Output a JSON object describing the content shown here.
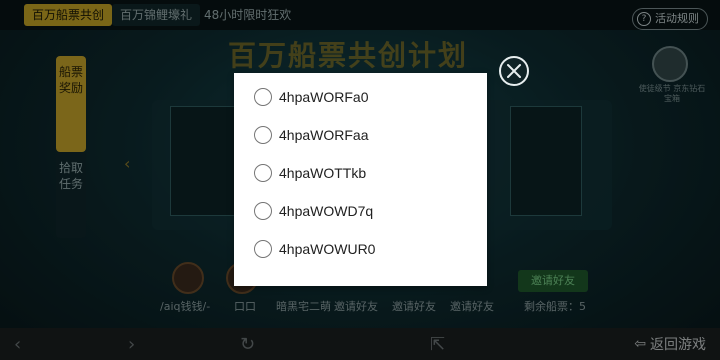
{
  "top_tabs": [
    {
      "label": "百万船票共创"
    },
    {
      "label": "百万锦鲤壕礼"
    },
    {
      "label": "48小时限时狂欢"
    }
  ],
  "rules_button": {
    "label": "活动规则"
  },
  "banner_title": "百万船票共创计划",
  "side_tabs": [
    {
      "label": "船票奖励"
    },
    {
      "label": "拾取任务"
    }
  ],
  "right_panel": {
    "caption": "使徒级节\n京东钻石宝箱"
  },
  "friends": [
    {
      "name": "/aiq钱钱/-"
    },
    {
      "name": "口口"
    },
    {
      "name": "暗黑宅二萌"
    },
    {
      "name": "邀请好友"
    },
    {
      "name": "邀请好友"
    },
    {
      "name": "邀请好友"
    }
  ],
  "invite_button": {
    "label": "邀请好友"
  },
  "remaining": {
    "label": "剩余船票：5"
  },
  "nav": {
    "back_label": "返回游戏"
  },
  "dialog": {
    "options": [
      {
        "label": "4hpaWORFa0",
        "selected": false
      },
      {
        "label": "4hpaWORFaa",
        "selected": false
      },
      {
        "label": "4hpaWOTTkb",
        "selected": false
      },
      {
        "label": "4hpaWOWD7q",
        "selected": false
      },
      {
        "label": "4hpaWOWUR0",
        "selected": false
      }
    ]
  },
  "colors": {
    "accent_gold": "#c7a52b",
    "dialog_bg": "#ffffff",
    "radio_border": "#757575"
  }
}
